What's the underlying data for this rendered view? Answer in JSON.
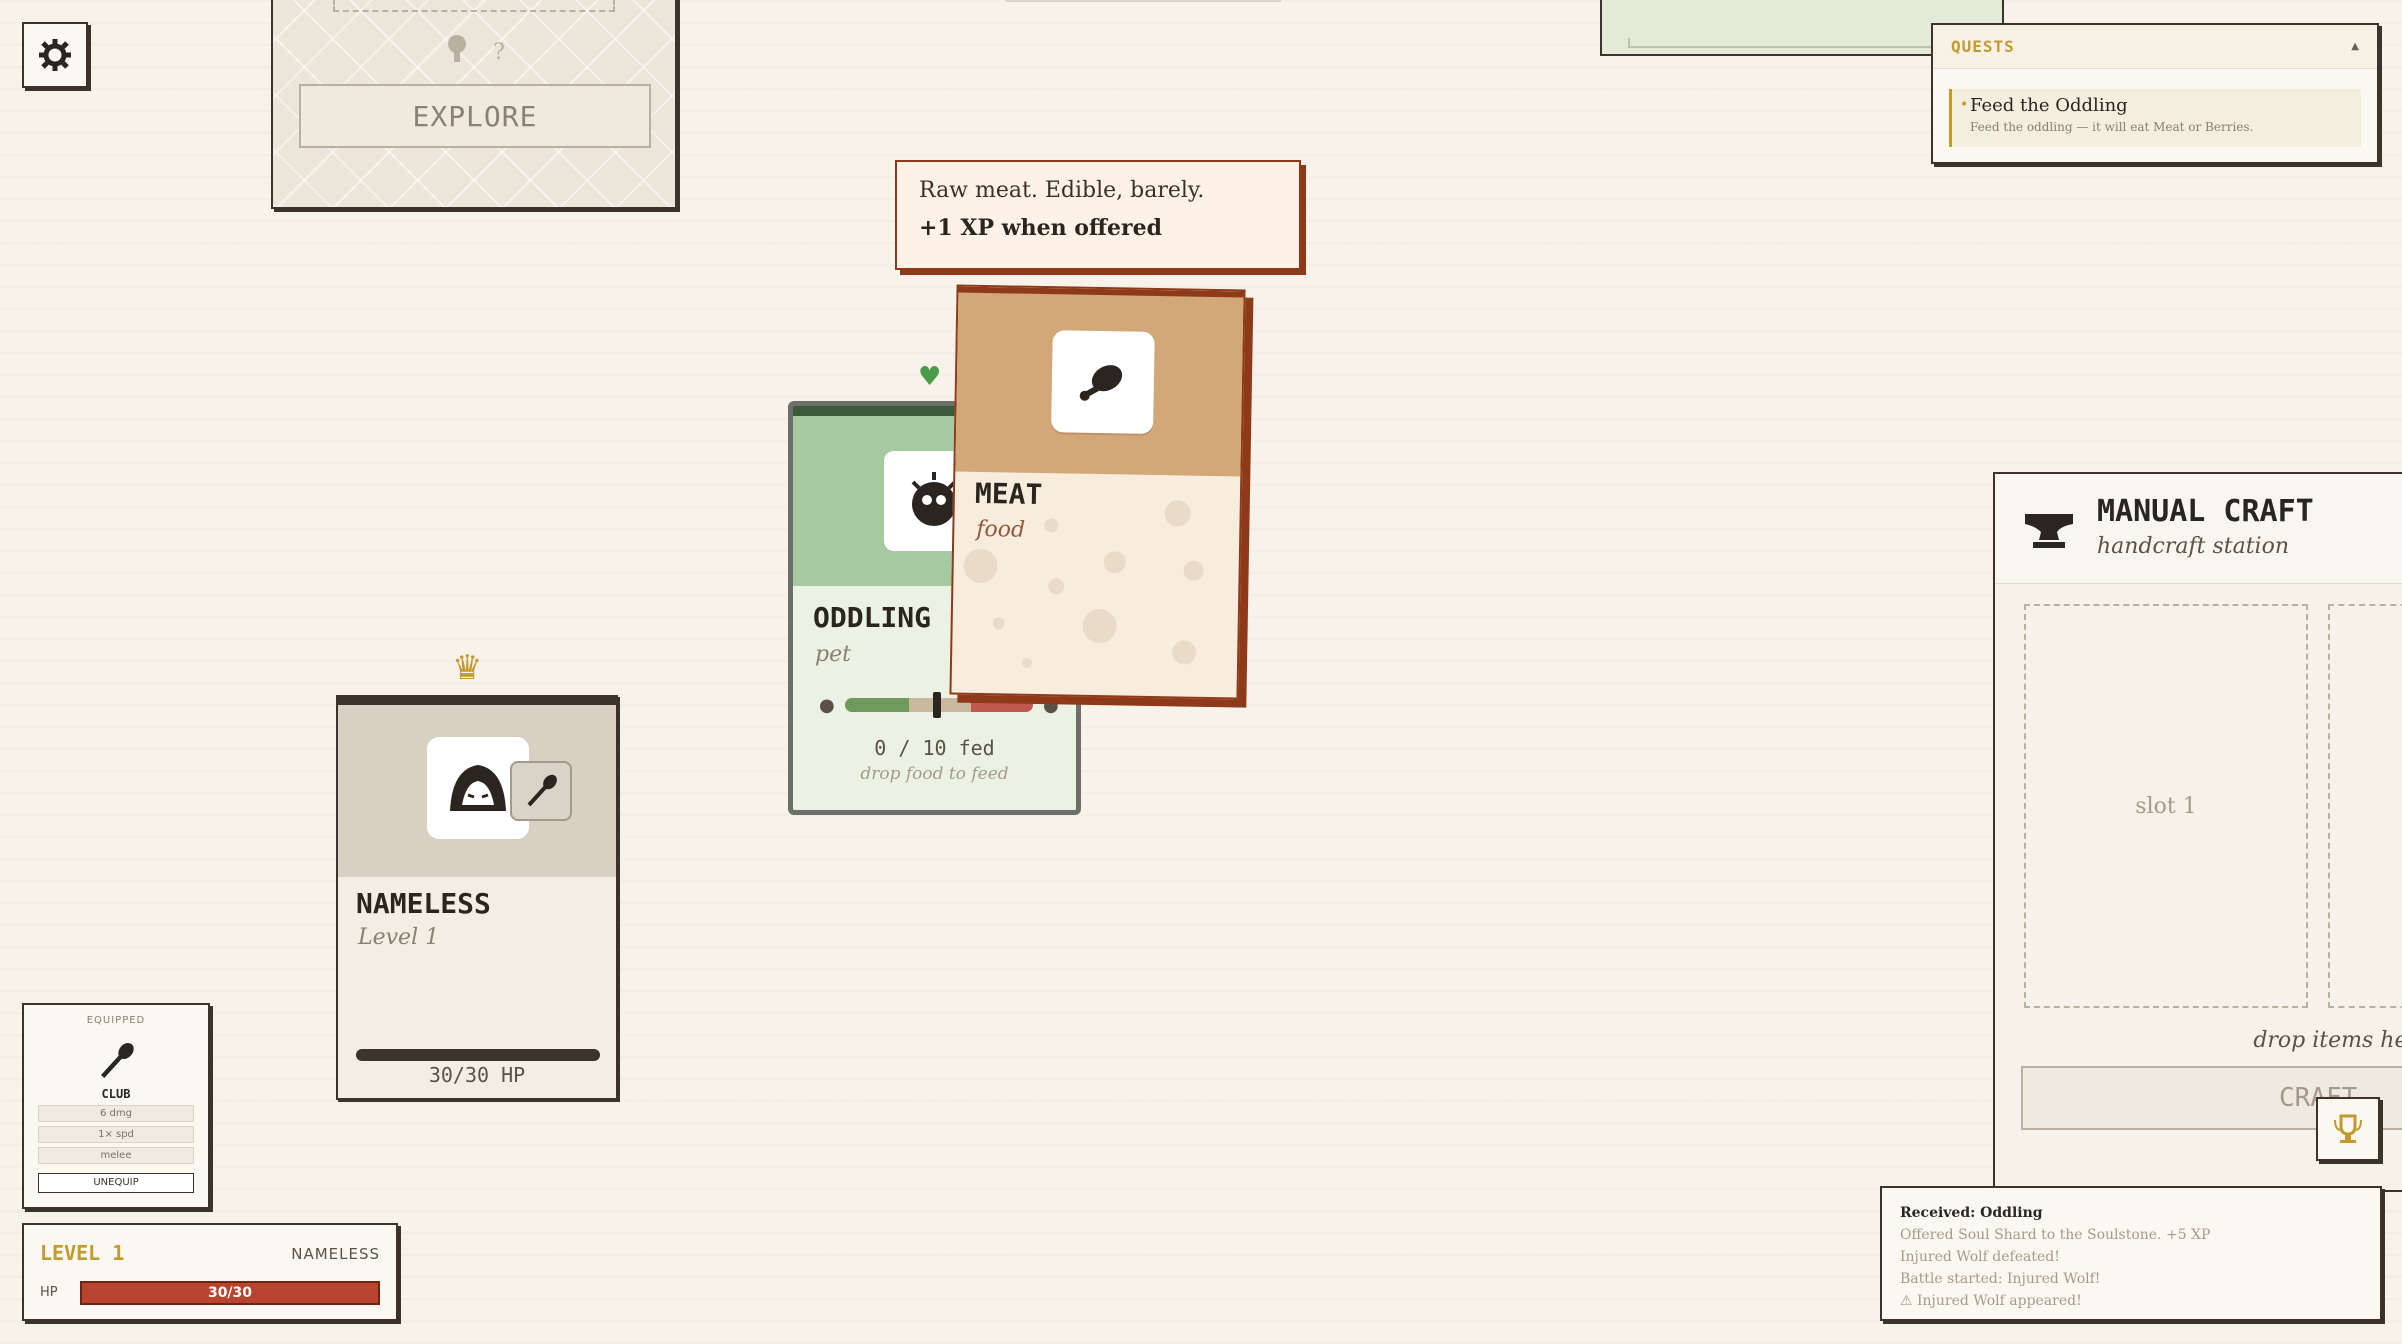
{
  "explore": {
    "hint_mark": "?",
    "button_label": "EXPLORE"
  },
  "quests": {
    "title": "QUESTS",
    "toggle": "▲",
    "items": [
      {
        "name": "Feed the Oddling",
        "description": "Feed the oddling — it will eat Meat or Berries."
      }
    ]
  },
  "tooltip": {
    "description": "Raw meat. Edible, barely.",
    "xp_line": "+1 XP when offered"
  },
  "oddling_card": {
    "name": "ODDLING",
    "type": "pet",
    "fed_progress": 0.0,
    "fed_count": "0 / 10 fed",
    "hint": "drop food to feed"
  },
  "meat_card": {
    "name": "MEAT",
    "type": "food"
  },
  "player_card": {
    "name": "NAMELESS",
    "level": "Level 1",
    "hp_text": "30/30 HP",
    "hp_fraction": 1.0
  },
  "equipped": {
    "title": "EQUIPPED",
    "item_name": "CLUB",
    "stats": [
      "6 dmg",
      "1× spd",
      "melee"
    ],
    "unequip_label": "UNEQUIP"
  },
  "status": {
    "level_label": "LEVEL 1",
    "player_name": "NAMELESS",
    "hp_label": "HP",
    "hp_value": "30/30",
    "hp_fraction": 1.0
  },
  "craft": {
    "title": "MANUAL CRAFT",
    "subtitle": "handcraft station",
    "slot1_label": "slot 1",
    "drop_hint": "drop items here",
    "button_label": "CRAFT"
  },
  "log": {
    "lines": [
      "Received: Oddling",
      "Offered Soul Shard to the Soulstone. +5 XP",
      "Injured Wolf defeated!",
      "Battle started: Injured Wolf!",
      "⚠ Injured Wolf appeared!"
    ]
  },
  "colors": {
    "accent_gold": "#c29a2e",
    "hp_red": "#b8442f",
    "meat_border": "#8e3a1a",
    "pet_green": "#a6c9a2"
  }
}
